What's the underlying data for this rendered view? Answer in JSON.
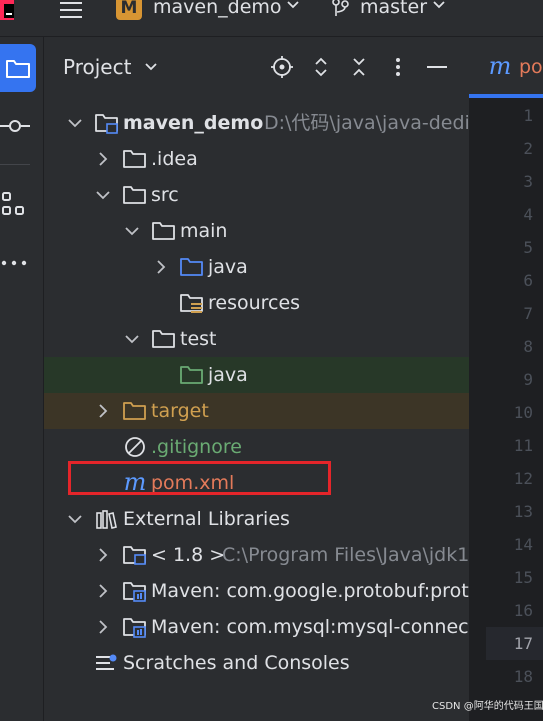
{
  "topbar": {
    "project_badge": "M",
    "project_name": "maven_demo",
    "branch": "master"
  },
  "panel": {
    "title": "Project"
  },
  "tree": {
    "root": {
      "name": "maven_demo",
      "path": "D:\\代码\\java\\java-dedi"
    },
    "idea": ".idea",
    "src": "src",
    "main": "main",
    "main_java": "java",
    "resources": "resources",
    "test": "test",
    "test_java": "java",
    "target": "target",
    "gitignore": ".gitignore",
    "pom": "pom.xml",
    "external_libraries": "External Libraries",
    "jdk": {
      "name": "< 1.8 >",
      "path": "C:\\Program Files\\Java\\jdk1"
    },
    "maven1": "Maven: com.google.protobuf:proto",
    "maven2": "Maven: com.mysql:mysql-connecto",
    "scratches": "Scratches and Consoles"
  },
  "editor": {
    "tab_label": "po",
    "tab_icon_letter": "m",
    "line_numbers": [
      "1",
      "2",
      "3",
      "4",
      "5",
      "6",
      "7",
      "8",
      "9",
      "10",
      "11",
      "12",
      "13",
      "14",
      "15",
      "16",
      "17",
      "18"
    ],
    "current_line": "17"
  },
  "watermark": "CSDN @阿华的代码王国",
  "colors": {
    "accent": "#3574f0",
    "highlight_box": "#e5252a",
    "orange_text": "#d0a050",
    "green_text": "#6aab73",
    "maven_blue": "#5c9aff"
  }
}
